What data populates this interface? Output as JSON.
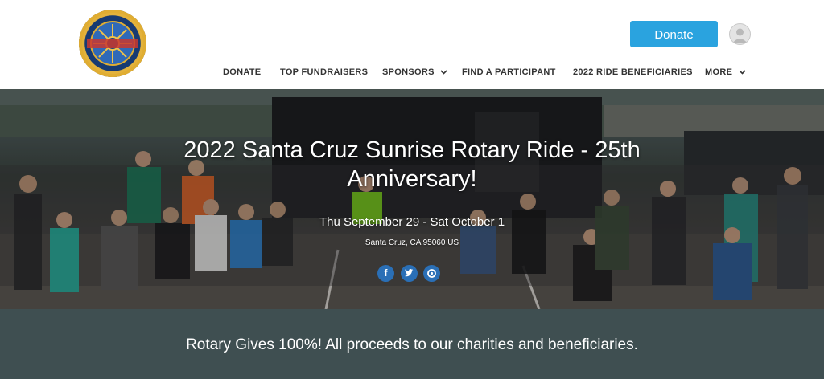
{
  "header": {
    "logo_text": "JON & KEN'S SANTA CRUZ SUNRISE ROTARY BIKE RIDE MOST EXCELLENT ADVENTURE",
    "donate_label": "Donate",
    "donate_color": "#2aa3df"
  },
  "nav": {
    "items": [
      {
        "label": "DONATE",
        "has_dropdown": false
      },
      {
        "label": "TOP FUNDRAISERS",
        "has_dropdown": false
      },
      {
        "label": "SPONSORS",
        "has_dropdown": true
      },
      {
        "label": "FIND A PARTICIPANT",
        "has_dropdown": false
      },
      {
        "label": "2022 RIDE BENEFICIARIES",
        "has_dropdown": false
      },
      {
        "label": "MORE",
        "has_dropdown": true
      }
    ]
  },
  "hero": {
    "title": "2022 Santa Cruz Sunrise Rotary Ride - 25th Anniversary!",
    "date": "Thu September 29 - Sat October 1",
    "location": "Santa Cruz, CA 95060 US",
    "share": [
      {
        "icon": "facebook-icon",
        "glyph": "f"
      },
      {
        "icon": "twitter-icon",
        "glyph": "t"
      },
      {
        "icon": "email-icon",
        "glyph": "@"
      }
    ]
  },
  "banner": {
    "text": "Rotary Gives 100%! All proceeds to our charities and beneficiaries.",
    "background": "#3f4f51"
  }
}
